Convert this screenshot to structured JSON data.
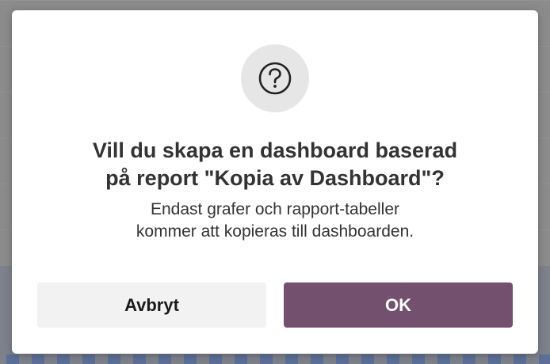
{
  "dialog": {
    "icon": "question-circle-icon",
    "title_lines": [
      "Vill du skapa en dashboard baserad",
      "på report \"Kopia av Dashboard\"?"
    ],
    "message_lines": [
      "Endast grafer och rapport-tabeller",
      "kommer att kopieras till dashboarden."
    ],
    "cancel_label": "Avbryt",
    "ok_label": "OK"
  },
  "colors": {
    "overlay": "#8b8b8b",
    "dialog_background": "#ffffff",
    "icon_background": "#e6e6e6",
    "cancel_button": "#f2f2f2",
    "ok_button": "#73516e",
    "text": "#333333"
  }
}
